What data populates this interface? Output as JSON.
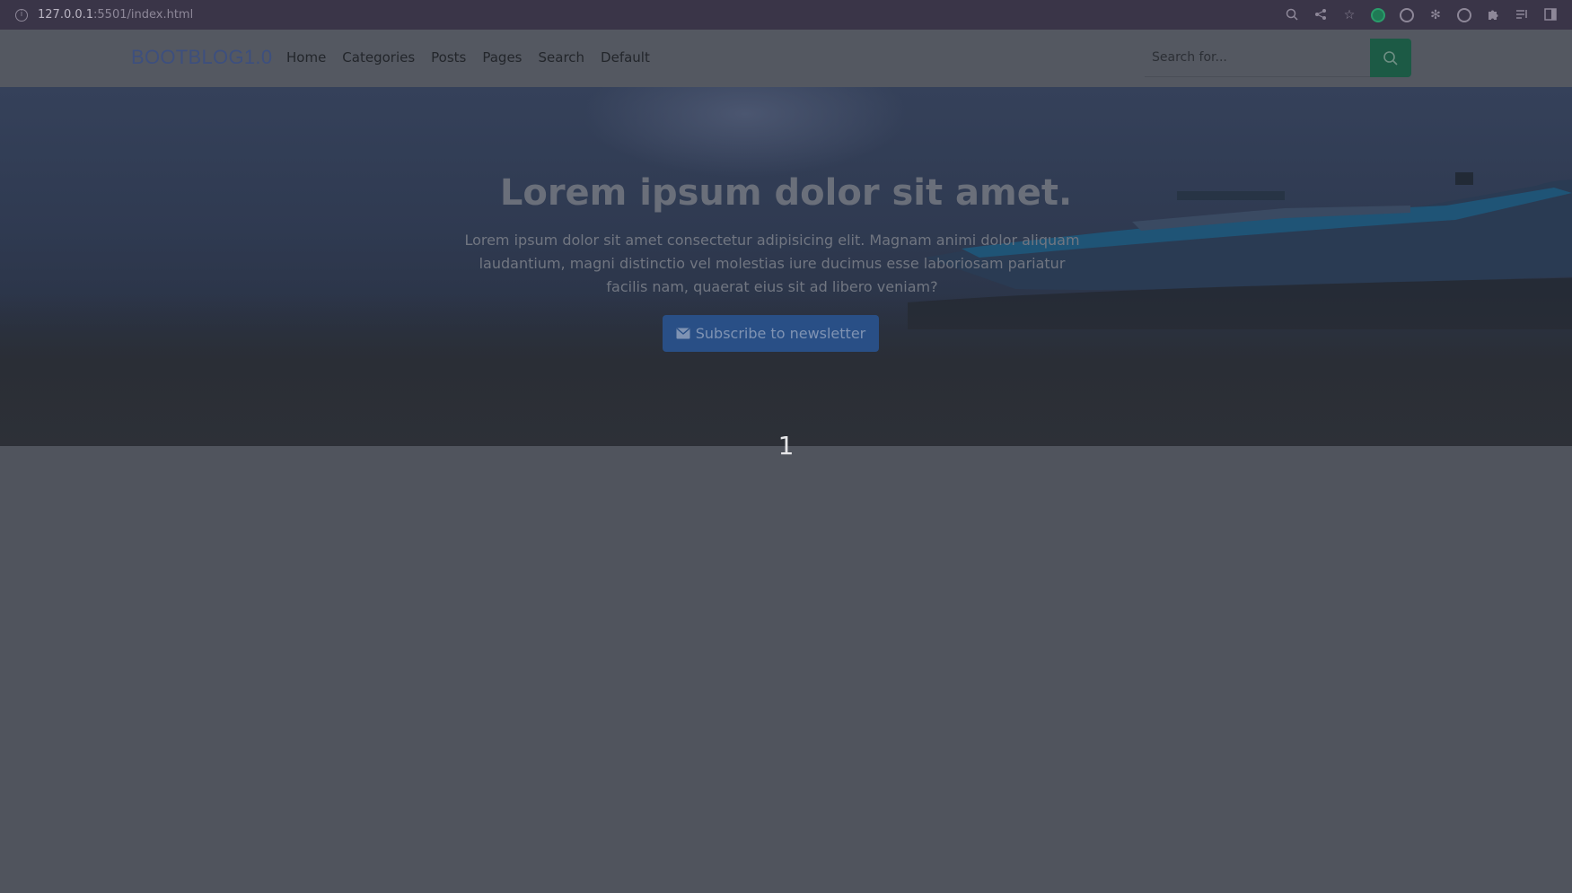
{
  "browser": {
    "url_host": "127.0.0.1",
    "url_rest": ":5501/index.html"
  },
  "navbar": {
    "brand": "BOOTBLOG1.0",
    "links": [
      "Home",
      "Categories",
      "Posts",
      "Pages",
      "Search",
      "Default"
    ],
    "search_placeholder": "Search for..."
  },
  "hero": {
    "title": "Lorem ipsum dolor sit amet.",
    "text": "Lorem ipsum dolor sit amet consectetur adipisicing elit. Magnam animi dolor aliquam laudantium, magni distinctio vel molestias iure ducimus esse laboriosam pariatur facilis nam, quaerat eius sit ad libero veniam?",
    "button_label": "Subscribe to newsletter"
  },
  "page_number": "1",
  "colors": {
    "search_button": "#1c5a45",
    "subscribe_button": "#294f86",
    "brand": "#3d4f7e"
  }
}
